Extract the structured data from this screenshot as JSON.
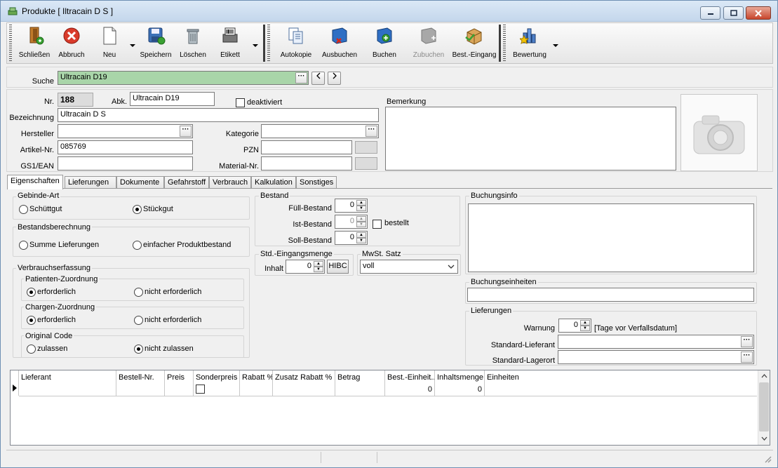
{
  "window": {
    "title": "Produkte [ Iltracain D S ]"
  },
  "toolbar": {
    "buttons": [
      {
        "label": "Schließen",
        "icon": "door-exit-icon"
      },
      {
        "label": "Abbruch",
        "icon": "cancel-icon"
      },
      {
        "label": "Neu",
        "icon": "new-document-icon"
      },
      {
        "label": "Speichern",
        "icon": "save-disk-icon"
      },
      {
        "label": "Löschen",
        "icon": "trash-can-icon"
      },
      {
        "label": "Etikett",
        "icon": "barcode-printer-icon"
      },
      {
        "label": "Autokopie",
        "icon": "copy-documents-icon"
      },
      {
        "label": "Ausbuchen",
        "icon": "book-remove-icon"
      },
      {
        "label": "Buchen",
        "icon": "book-add-icon"
      },
      {
        "label": "Zubuchen",
        "icon": "book-add-gray-icon"
      },
      {
        "label": "Best.-Eingang",
        "icon": "package-icon"
      },
      {
        "label": "Bewertung",
        "icon": "rating-chart-icon"
      }
    ]
  },
  "search": {
    "label": "Suche",
    "value": "Ultracain D19"
  },
  "product": {
    "nr_label": "Nr.",
    "nr": "188",
    "abk_label": "Abk.",
    "abk": "Ultracain D19",
    "deaktiviert_label": "deaktiviert",
    "bezeichnung_label": "Bezeichnung",
    "bezeichnung": "Ultracain D S",
    "hersteller_label": "Hersteller",
    "hersteller": "",
    "kategorie_label": "Kategorie",
    "kategorie": "",
    "artikelnr_label": "Artikel-Nr.",
    "artikelnr": "085769",
    "pzn_label": "PZN",
    "pzn": "",
    "gs1_label": "GS1/EAN",
    "gs1": "",
    "materialnr_label": "Material-Nr.",
    "materialnr": "",
    "bemerkung_label": "Bemerkung",
    "bemerkung": ""
  },
  "tabs": [
    "Eigenschaften",
    "Lieferungen",
    "Dokumente",
    "Gefahrstoff",
    "Verbrauch",
    "Kalkulation",
    "Sonstiges"
  ],
  "eigenschaften": {
    "gebinde": {
      "title": "Gebinde-Art",
      "opt1": "Schüttgut",
      "opt2": "Stückgut"
    },
    "bestandsberechnung": {
      "title": "Bestandsberechnung",
      "opt1": "Summe Lieferungen",
      "opt2": "einfacher Produktbestand"
    },
    "verbrauch": {
      "title": "Verbrauchserfassung",
      "patient": {
        "title": "Patienten-Zuordnung",
        "opt1": "erforderlich",
        "opt2": "nicht erforderlich"
      },
      "chargen": {
        "title": "Chargen-Zuordnung",
        "opt1": "erforderlich",
        "opt2": "nicht erforderlich"
      },
      "original": {
        "title": "Original Code",
        "opt1": "zulassen",
        "opt2": "nicht zulassen"
      }
    },
    "bestand": {
      "title": "Bestand",
      "fuell_label": "Füll-Bestand",
      "fuell": "0",
      "ist_label": "Ist-Bestand",
      "ist": "0",
      "bestellt_label": "bestellt",
      "soll_label": "Soll-Bestand",
      "soll": "0"
    },
    "eingang": {
      "title": "Std.-Eingangsmenge",
      "inhalt_label": "Inhalt",
      "inhalt": "0",
      "hibc": "HIBC"
    },
    "mwst": {
      "title": "MwSt. Satz",
      "value": "voll"
    },
    "buchungsinfo": {
      "title": "Buchungsinfo"
    },
    "buchungseinheiten": {
      "title": "Buchungseinheiten"
    },
    "lieferungen": {
      "title": "Lieferungen",
      "warnung_label": "Warnung",
      "warnung": "0",
      "warnung_unit": "[Tage vor Verfallsdatum]",
      "lieferant_label": "Standard-Lieferant",
      "lagerort_label": "Standard-Lagerort"
    }
  },
  "grid": {
    "columns": [
      "Lieferant",
      "Bestell-Nr.",
      "Preis",
      "Sonderpreis",
      "Rabatt %",
      "Zusatz Rabatt %",
      "Betrag",
      "Best.-Einheit...",
      "Inhaltsmenge",
      "Einheiten"
    ],
    "row": {
      "best_einheit": "0",
      "inhaltsmenge": "0"
    }
  }
}
